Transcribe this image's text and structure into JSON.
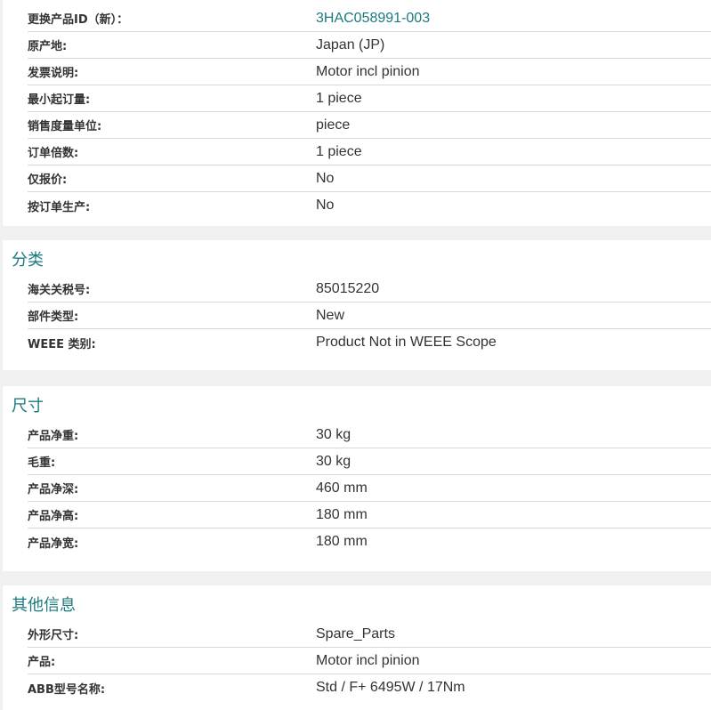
{
  "sections": [
    {
      "title": "",
      "rows": [
        {
          "label": "更换产品ID（新）：",
          "value": "3HAC058991-003"
        },
        {
          "label": "原产地:",
          "value": "Japan (JP)"
        },
        {
          "label": "发票说明:",
          "value": "Motor incl pinion"
        },
        {
          "label": "最小起订量:",
          "value": "1 piece"
        },
        {
          "label": "销售度量单位:",
          "value": "piece"
        },
        {
          "label": "订单倍数:",
          "value": "1 piece"
        },
        {
          "label": "仅报价:",
          "value": "No"
        },
        {
          "label": "按订单生产:",
          "value": "No"
        }
      ]
    },
    {
      "title": "分类",
      "rows": [
        {
          "label": "海关关税号:",
          "value": "85015220"
        },
        {
          "label": "部件类型:",
          "value": "New"
        },
        {
          "label": "WEEE 类别:",
          "value": "Product Not in WEEE Scope"
        }
      ]
    },
    {
      "title": "尺寸",
      "rows": [
        {
          "label": "产品净重:",
          "value": "30 kg"
        },
        {
          "label": "毛重:",
          "value": "30 kg"
        },
        {
          "label": "产品净深:",
          "value": "460 mm"
        },
        {
          "label": "产品净高:",
          "value": "180 mm"
        },
        {
          "label": "产品净宽:",
          "value": "180 mm"
        }
      ]
    },
    {
      "title": "其他信息",
      "rows": [
        {
          "label": "外形尺寸:",
          "value": "Spare_Parts"
        },
        {
          "label": "产品:",
          "value": "Motor incl pinion"
        },
        {
          "label": "ABB型号名称:",
          "value": "Std / F+ 6495W / 17Nm"
        }
      ]
    }
  ],
  "colors": {
    "link": "#1a7a80",
    "heading": "#1a7a80",
    "text": "#333333",
    "background": "#f0f0f0"
  }
}
